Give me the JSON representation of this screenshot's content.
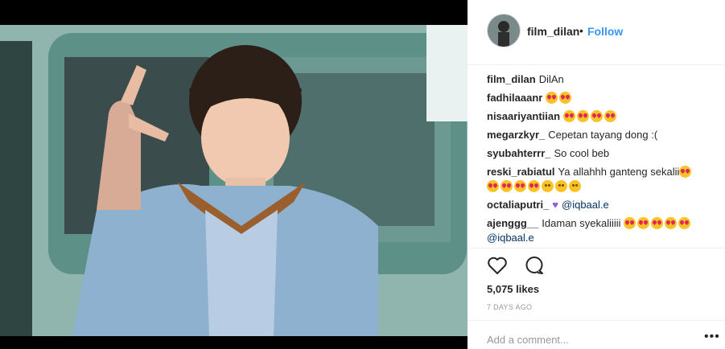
{
  "post": {
    "username": "film_dilan",
    "separator": "•",
    "follow_label": "Follow"
  },
  "comments": [
    {
      "user": "film_dilan",
      "text": "DilAn"
    },
    {
      "user": "fadhilaaanr",
      "text": ""
    },
    {
      "user": "nisaariyantiian",
      "text": ""
    },
    {
      "user": "megarzkyr_",
      "text": "Cepetan tayang dong :("
    },
    {
      "user": "syubahterrr_",
      "text": "So cool beb"
    },
    {
      "user": "reski_rabiatul",
      "text": "Ya allahhh ganteng sekalii"
    },
    {
      "user": "octaliaputri_",
      "text": "@iqbaal.e"
    },
    {
      "user": "ajenggg__",
      "text": "Idaman syekaliiiii",
      "text2": "@iqbaal.e"
    }
  ],
  "stats": {
    "likes": "5,075 likes",
    "time_ago": "7 DAYS AGO"
  },
  "comment_box": {
    "placeholder": "Add a comment...",
    "more_label": "•••"
  },
  "icons": [
    "heart-outline-icon",
    "comment-icon",
    "heart-emoji-eyes-icon",
    "purple-heart-icon",
    "blush-emoji-icon"
  ]
}
